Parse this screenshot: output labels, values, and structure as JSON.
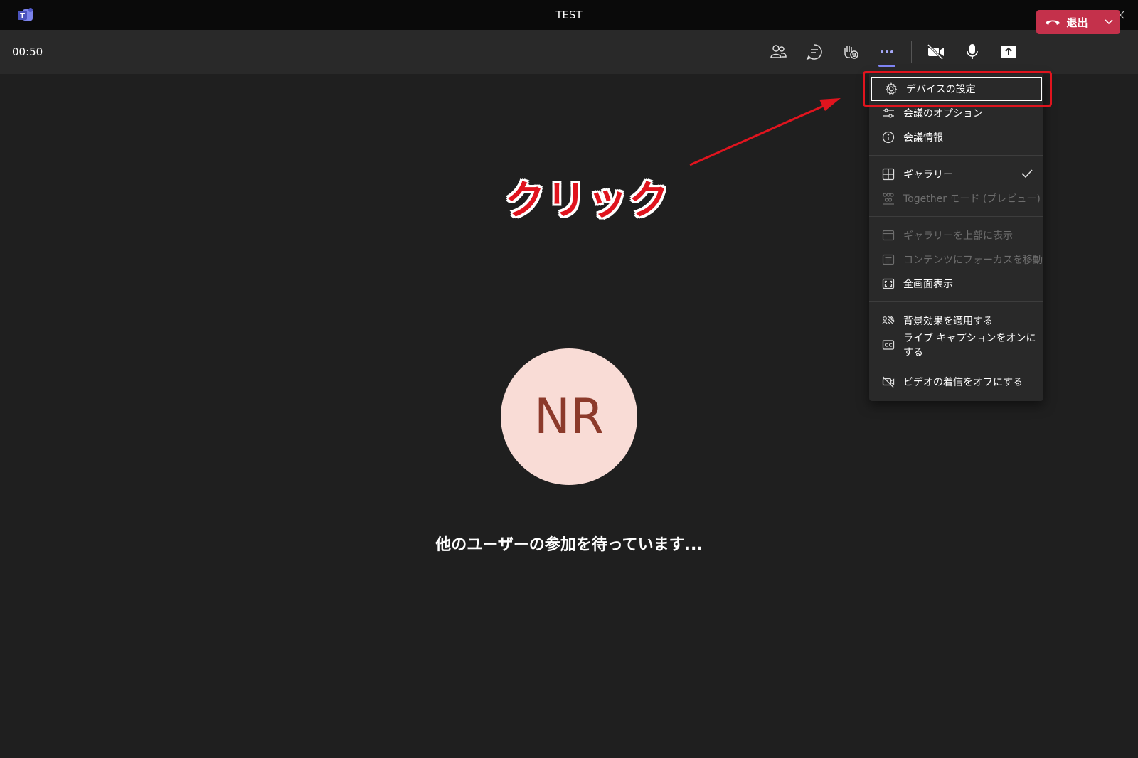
{
  "window": {
    "title": "TEST"
  },
  "toolbar": {
    "timer": "00:50",
    "leave_label": "退出"
  },
  "menu": {
    "items": [
      {
        "label": "デバイスの設定",
        "icon": "gear-icon",
        "disabled": false
      },
      {
        "label": "会議のオプション",
        "icon": "sliders-icon",
        "disabled": false
      },
      {
        "label": "会議情報",
        "icon": "info-icon",
        "disabled": false
      },
      {
        "label": "ギャラリー",
        "icon": "grid-icon",
        "disabled": false,
        "checked": true
      },
      {
        "label": "Together モード (プレビュー)",
        "icon": "together-icon",
        "disabled": true
      },
      {
        "label": "ギャラリーを上部に表示",
        "icon": "gallery-top-icon",
        "disabled": true
      },
      {
        "label": "コンテンツにフォーカスを移動",
        "icon": "focus-icon",
        "disabled": true
      },
      {
        "label": "全画面表示",
        "icon": "fullscreen-icon",
        "disabled": false
      },
      {
        "label": "背景効果を適用する",
        "icon": "background-effects-icon",
        "disabled": false
      },
      {
        "label": "ライブ キャプションをオンにする",
        "icon": "cc-icon",
        "disabled": false
      },
      {
        "label": "ビデオの着信をオフにする",
        "icon": "video-off-icon",
        "disabled": false
      }
    ]
  },
  "annotation": {
    "label": "クリック",
    "color": "#e0141e"
  },
  "main": {
    "avatar_initials": "NR",
    "status": "他のユーザーの参加を待っています..."
  },
  "colors": {
    "leave": "#c4314b",
    "accent": "#7f85f5",
    "avatar_bg": "#f9dcd6",
    "avatar_text": "#8c3a2b"
  }
}
